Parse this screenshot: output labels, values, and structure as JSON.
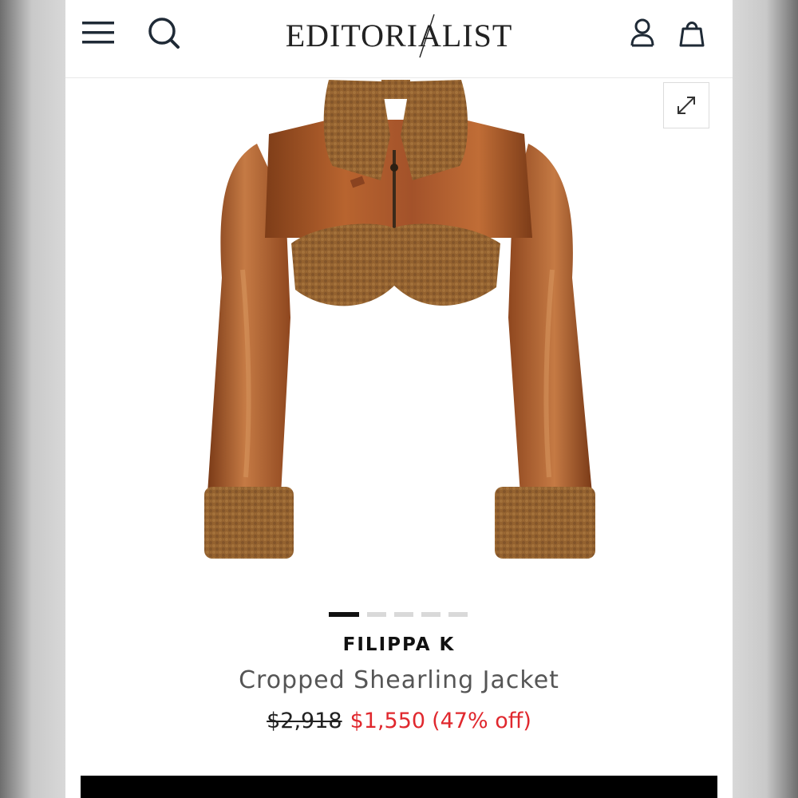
{
  "header": {
    "logo_text": "EDITORIALIST",
    "icons": [
      "menu-icon",
      "search-icon",
      "account-icon",
      "bag-icon"
    ]
  },
  "gallery": {
    "image_alt": "Cropped Shearling Jacket",
    "expand_icon": "expand-icon",
    "slide_count": 5,
    "active_slide": 1
  },
  "product": {
    "brand": "FILIPPA K",
    "name": "Cropped Shearling Jacket",
    "original_price": "$2,918",
    "sale_price": "$1,550",
    "discount": "(47% off)"
  },
  "colors": {
    "sale_red": "#e0282e",
    "leather": "#a9582a",
    "shearling": "#8f5f30"
  }
}
